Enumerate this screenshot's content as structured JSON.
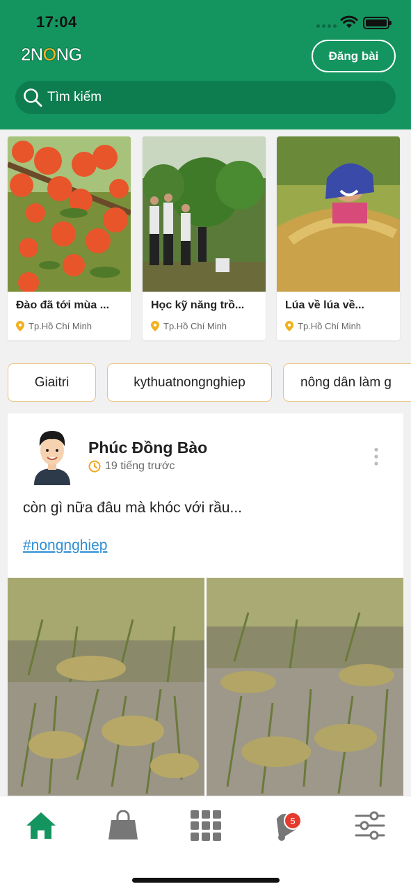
{
  "status_bar": {
    "time": "17:04"
  },
  "header": {
    "logo_text_pre": "2N",
    "logo_text_o": "O",
    "logo_text_post": "NG",
    "post_button": "Đăng bài",
    "search_placeholder": "Tìm kiếm"
  },
  "cards": [
    {
      "title": "Đào đã tới mùa ...",
      "location": "Tp.Hồ Chí Minh",
      "image": "peach-tree-photo"
    },
    {
      "title": "Học kỹ năng trồ...",
      "location": "Tp.Hồ Chí Minh",
      "image": "farmers-orchard-photo"
    },
    {
      "title": "Lúa về lúa về...",
      "location": "Tp.Hồ Chí Minh",
      "image": "rice-harvest-girl-photo"
    }
  ],
  "tags": [
    "Giaitri",
    "kythuatnongnghiep",
    "nông dân làm g"
  ],
  "post": {
    "author": "Phúc Đồng Bào",
    "time_ago": "19 tiếng trước",
    "text": "còn gì nữa đâu mà khóc với rầu...",
    "hashtag": "#nongnghiep",
    "photos": [
      "flooded-rice-field-photo-1",
      "flooded-rice-field-photo-2"
    ]
  },
  "tabbar": {
    "items": [
      "home-icon",
      "shopping-bag-icon",
      "grid-icon",
      "bell-icon",
      "settings-sliders-icon"
    ],
    "notification_count": "5"
  },
  "colors": {
    "brand_green": "#14955f",
    "accent_orange": "#f6b323",
    "tag_border": "#e8c27d",
    "link_blue": "#2d8fd5",
    "badge_red": "#e53b2f"
  }
}
